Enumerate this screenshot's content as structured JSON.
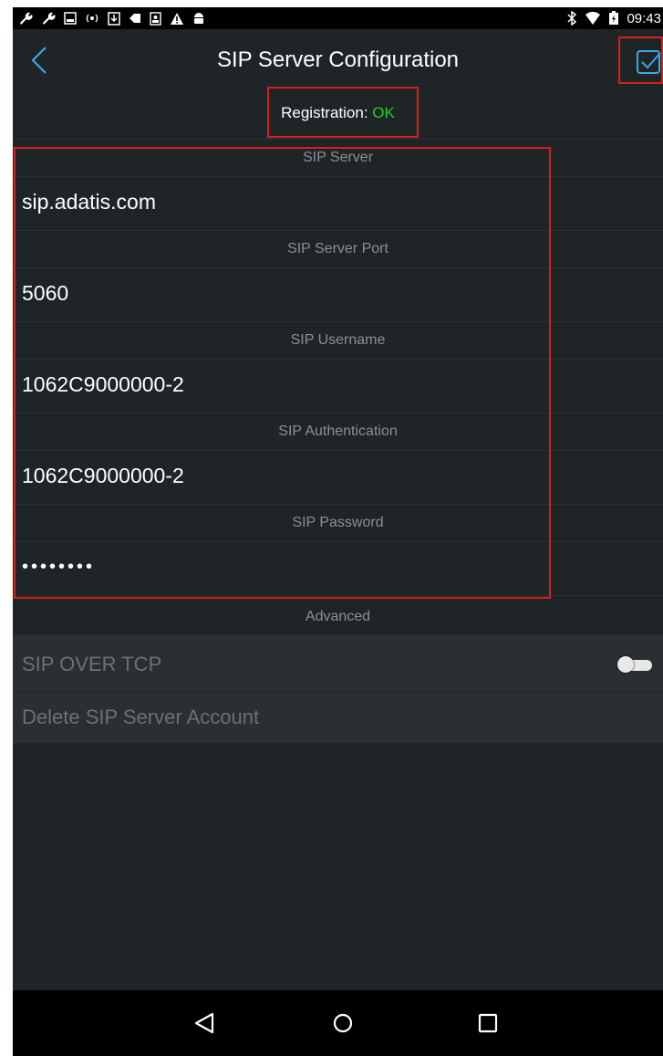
{
  "status_bar": {
    "time": "09:43",
    "left_icons": [
      "wrench-icon",
      "wrench-icon",
      "image-icon",
      "radio-icon",
      "download-icon",
      "tag-icon",
      "contact-icon",
      "warning-icon",
      "android-icon"
    ],
    "right_icons": [
      "bluetooth-icon",
      "wifi-icon",
      "battery-charging-icon"
    ]
  },
  "app_bar": {
    "title": "SIP Server Configuration",
    "back_icon": "chevron-left-icon",
    "save_icon": "checkbox-save-icon"
  },
  "registration": {
    "label": "Registration: ",
    "status": "OK",
    "status_color": "#1ed22a"
  },
  "fields": [
    {
      "header": "SIP Server",
      "value": "sip.adatis.com"
    },
    {
      "header": "SIP Server Port",
      "value": "5060"
    },
    {
      "header": "SIP Username",
      "value": "1062C9000000-2"
    },
    {
      "header": "SIP Authentication",
      "value": "1062C9000000-2"
    },
    {
      "header": "SIP Password",
      "value": "••••••••"
    }
  ],
  "advanced": {
    "header": "Advanced",
    "sip_over_tcp_label": "SIP OVER TCP",
    "sip_over_tcp_enabled": false,
    "delete_label": "Delete SIP Server Account"
  },
  "nav_bar": {
    "icons": [
      "back-triangle-icon",
      "home-circle-icon",
      "recents-square-icon"
    ]
  },
  "colors": {
    "background": "#1f2426",
    "highlight_box": "#d81e1e",
    "accent": "#3aa7e6"
  }
}
